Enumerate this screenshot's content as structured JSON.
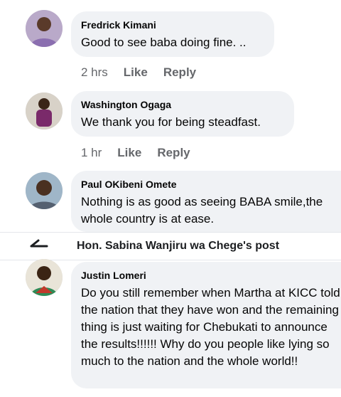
{
  "comments": [
    {
      "author": "Fredrick Kimani",
      "text": "Good to see baba doing fine. ..",
      "time": "2 hrs",
      "like": "Like",
      "reply": "Reply"
    },
    {
      "author": "Washington Ogaga",
      "text": "We thank you for being steadfast.",
      "time": "1 hr",
      "like": "Like",
      "reply": "Reply"
    },
    {
      "author": "Paul OKibeni Omete",
      "text": "Nothing is as good as seeing BABA smile,the whole country is at ease."
    },
    {
      "author": "Justin Lomeri",
      "text": "Do you still remember when Martha at KICC told the nation that they have won and the remaining thing is just waiting for Chebukati to announce the results!!!!!! Why do you people like lying so much to the nation and the whole world!!"
    }
  ],
  "post_bar": {
    "title": "Hon. Sabina Wanjiru wa Chege's post",
    "back_icon": "back-arrow-icon"
  },
  "colors": {
    "bubble": "#f0f2f5",
    "meta": "#65676b",
    "text": "#050505"
  }
}
